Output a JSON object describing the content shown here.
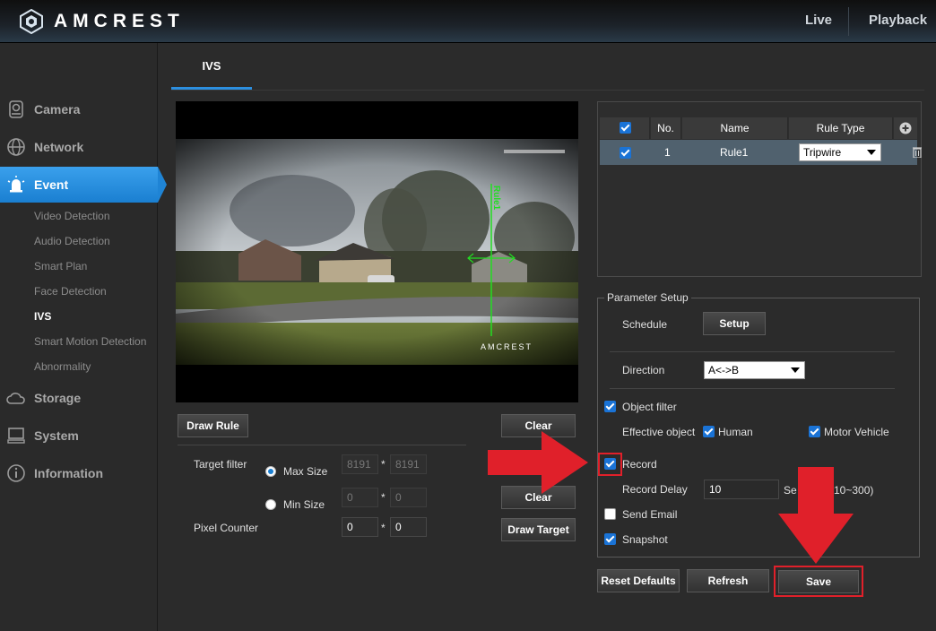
{
  "header": {
    "brand": "AMCREST",
    "nav": [
      "Live",
      "Playback"
    ]
  },
  "sidebar": {
    "items": [
      {
        "label": "Camera",
        "icon": "camera-icon"
      },
      {
        "label": "Network",
        "icon": "globe-icon"
      },
      {
        "label": "Event",
        "icon": "alarm-icon",
        "active": true
      },
      {
        "label": "Storage",
        "icon": "cloud-icon"
      },
      {
        "label": "System",
        "icon": "monitor-icon"
      },
      {
        "label": "Information",
        "icon": "info-icon"
      }
    ],
    "event_sub": [
      "Video Detection",
      "Audio Detection",
      "Smart Plan",
      "Face Detection",
      "IVS",
      "Smart Motion Detection",
      "Abnormality"
    ]
  },
  "tabs": [
    "IVS"
  ],
  "video": {
    "watermark": "AMCREST",
    "rule_label": "Rule1"
  },
  "left_controls": {
    "draw_rule": "Draw Rule",
    "clear": "Clear",
    "target_filter_label": "Target filter",
    "max_size_label": "Max Size",
    "min_size_label": "Min Size",
    "max_w": "8191",
    "max_h": "8191",
    "min_w": "0",
    "min_h": "0",
    "times": "*",
    "pixel_counter_label": "Pixel Counter",
    "pixel_w": "0",
    "pixel_h": "0",
    "clear2": "Clear",
    "draw_target": "Draw Target"
  },
  "rules_table": {
    "headers": [
      "No.",
      "Name",
      "Rule Type"
    ],
    "rows": [
      {
        "no": "1",
        "name": "Rule1",
        "type": "Tripwire"
      }
    ]
  },
  "params": {
    "title": "Parameter Setup",
    "schedule_label": "Schedule",
    "setup_btn": "Setup",
    "direction_label": "Direction",
    "direction_value": "A<->B",
    "object_filter": "Object filter",
    "effective_object": "Effective object",
    "human": "Human",
    "motor_vehicle": "Motor Vehicle",
    "record": "Record",
    "record_delay_label": "Record Delay",
    "record_delay_value": "10",
    "record_delay_unit_left": "Se",
    "record_delay_unit_right": "10~300)",
    "send_email": "Send Email",
    "snapshot": "Snapshot"
  },
  "footer_buttons": {
    "reset": "Reset Defaults",
    "refresh": "Refresh",
    "save": "Save"
  },
  "colors": {
    "accent": "#1a7fd1",
    "highlight": "#e0202a"
  }
}
